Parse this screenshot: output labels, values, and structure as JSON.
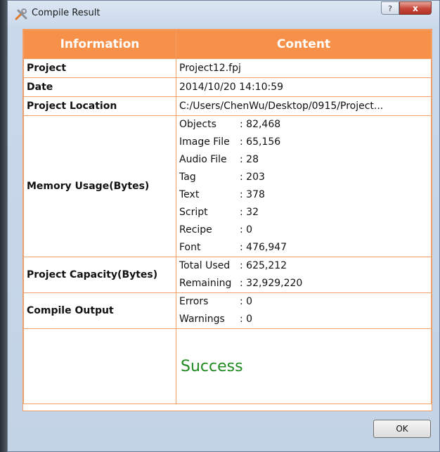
{
  "window": {
    "title": "Compile Result",
    "help_label": "?",
    "close_label": "x"
  },
  "table": {
    "headers": [
      "Information",
      "Content"
    ],
    "project": {
      "label": "Project",
      "value": "Project12.fpj"
    },
    "date": {
      "label": "Date",
      "value": "2014/10/20 14:10:59"
    },
    "location": {
      "label": "Project Location",
      "value": "C:/Users/ChenWu/Desktop/0915/Project..."
    },
    "memory": {
      "label": "Memory Usage(Bytes)",
      "items": [
        {
          "k": "Objects",
          "v": ": 82,468"
        },
        {
          "k": "Image File",
          "v": ": 65,156"
        },
        {
          "k": "Audio File",
          "v": ": 28"
        },
        {
          "k": "Tag",
          "v": ": 203"
        },
        {
          "k": "Text",
          "v": ": 378"
        },
        {
          "k": "Script",
          "v": ": 32"
        },
        {
          "k": "Recipe",
          "v": ": 0"
        },
        {
          "k": "Font",
          "v": ": 476,947"
        }
      ]
    },
    "capacity": {
      "label": "Project Capacity(Bytes)",
      "items": [
        {
          "k": "Total Used",
          "v": ": 625,212"
        },
        {
          "k": "Remaining",
          "v": ": 32,929,220"
        }
      ]
    },
    "compile": {
      "label": "Compile Output",
      "items": [
        {
          "k": "Errors",
          "v": ": 0"
        },
        {
          "k": "Warnings",
          "v": ": 0"
        }
      ]
    },
    "result": "Success"
  },
  "ok_label": "OK",
  "colors": {
    "header_bg": "#f7914a",
    "border": "#f0a068",
    "success": "#1f8a1f"
  }
}
